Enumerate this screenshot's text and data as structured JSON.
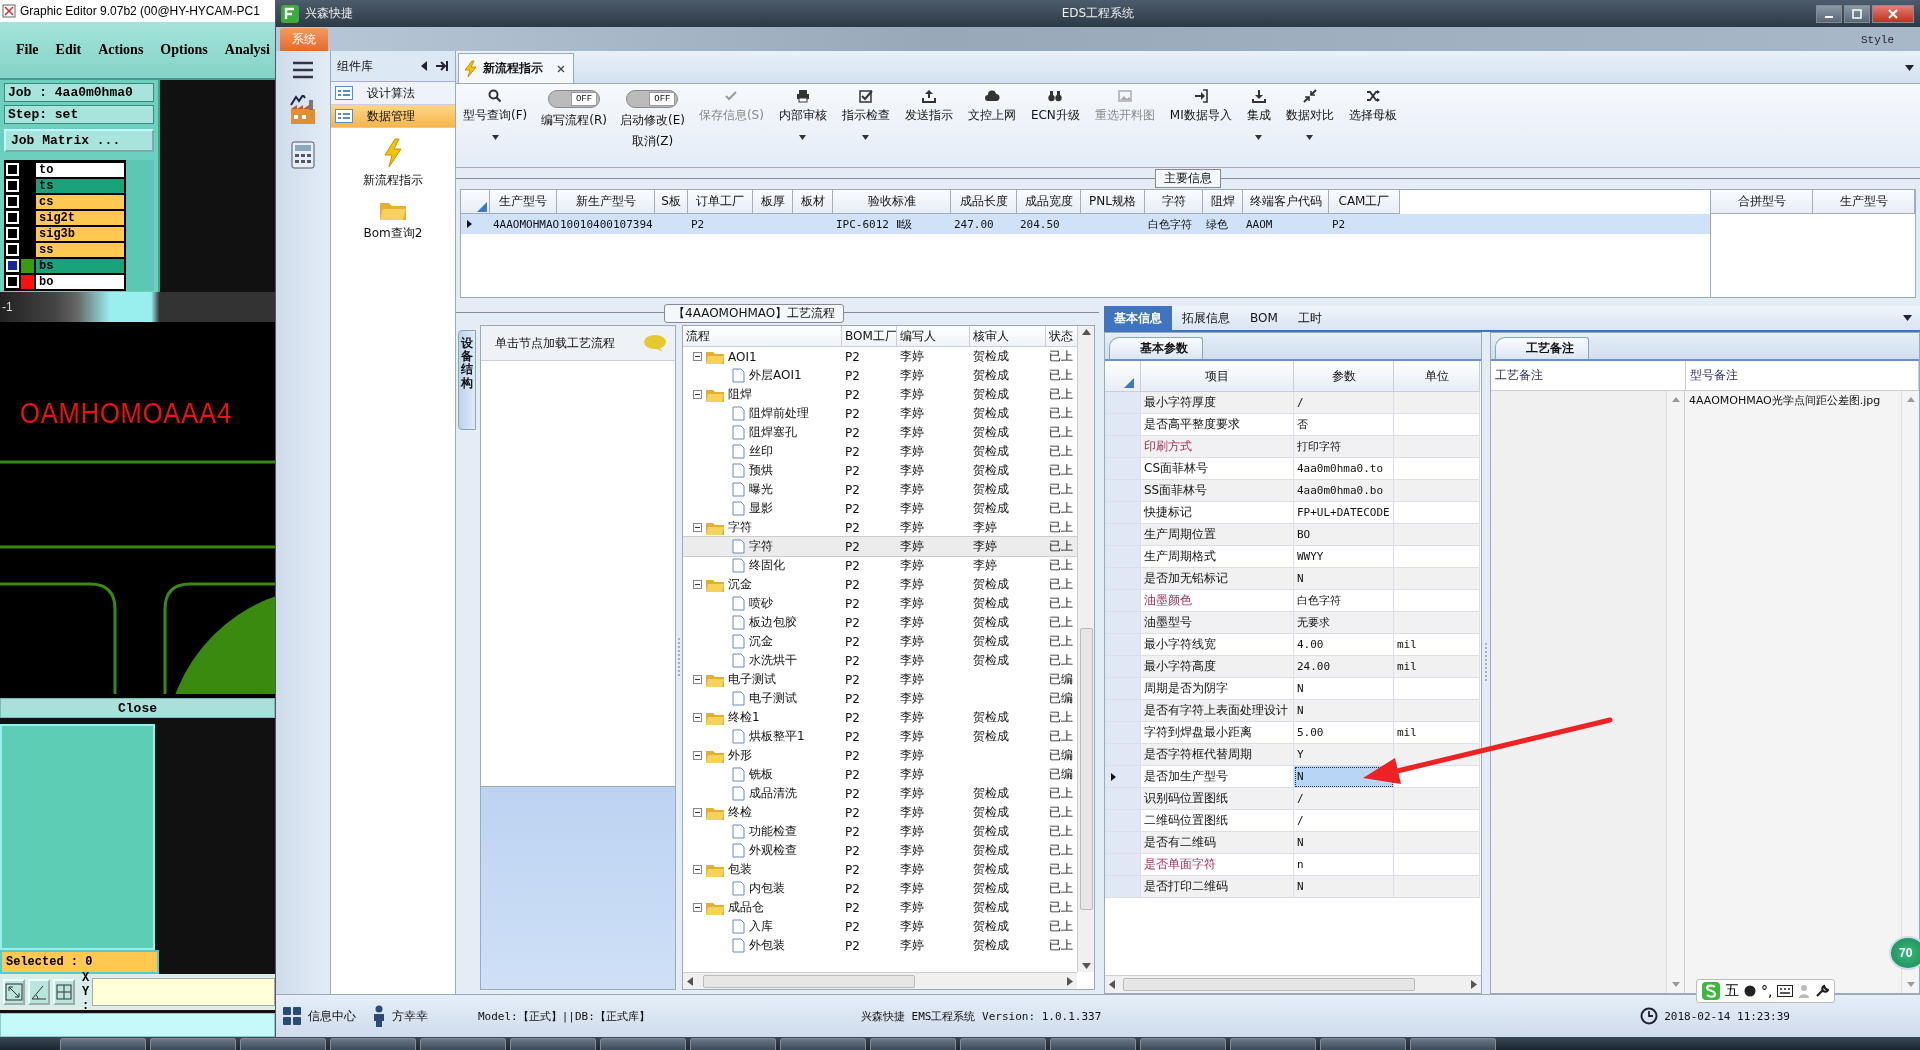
{
  "graphic_editor": {
    "title": "Graphic Editor 9.07b2 (00@HY-HYCAM-PC1",
    "menu": [
      "File",
      "Edit",
      "Actions",
      "Options",
      "Analysi"
    ],
    "job": "Job : 4aa0m0hma0",
    "step": "Step: set",
    "matrix_button": "Job Matrix ...",
    "layers": [
      {
        "name": "to",
        "color": "#ffffff",
        "selected": false
      },
      {
        "name": "ts",
        "color": "#1aa37a",
        "selected": false
      },
      {
        "name": "cs",
        "color": "#ffc850",
        "selected": false
      },
      {
        "name": "sig2t",
        "color": "#ffc850",
        "selected": false
      },
      {
        "name": "sig3b",
        "color": "#ffc850",
        "selected": false
      },
      {
        "name": "ss",
        "color": "#ffc850",
        "selected": false
      },
      {
        "name": "bs",
        "color": "#1aa37a",
        "swatch": {
          "color": "#3a9a10"
        },
        "selected": true
      },
      {
        "name": "bo",
        "color": "#ffffff",
        "swatch": {
          "color": "#ff1010"
        },
        "selected": false
      }
    ],
    "ruler": "-1",
    "canvas_text": "OAMHOMOAAA4",
    "close_button": "Close",
    "selected_count": "Selected : 0",
    "xy_label": "X Y :"
  },
  "window": {
    "app_name": "兴森快捷",
    "title": "EDS工程系统"
  },
  "system_menu": {
    "label": "系统",
    "background_text": "Style"
  },
  "component_panel": {
    "title": "组件库",
    "items": [
      {
        "label": "设计算法",
        "selected": false
      },
      {
        "label": "数据管理",
        "selected": true
      }
    ],
    "launchers": [
      {
        "label": "新流程指示",
        "kind": "bolt"
      },
      {
        "label": "Bom查询2",
        "kind": "folder"
      }
    ]
  },
  "document_tab": {
    "label": "新流程指示",
    "selected": true
  },
  "toolbar": [
    {
      "kind": "button",
      "label": "型号查询(F)",
      "dropdown": true,
      "disabled": false
    },
    {
      "kind": "toggle",
      "label": "编写流程(R)",
      "toggle": "OFF",
      "on": false
    },
    {
      "kind": "toggle",
      "label": "启动修改(E)",
      "sublabel": "取消(Z)",
      "toggle": "OFF",
      "on": false
    },
    {
      "kind": "button",
      "label": "保存信息(S)",
      "dropdown": false,
      "disabled": true
    },
    {
      "kind": "button",
      "label": "内部审核",
      "dropdown": true,
      "disabled": false
    },
    {
      "kind": "button",
      "label": "指示检查",
      "dropdown": true,
      "disabled": false
    },
    {
      "kind": "button",
      "label": "发送指示",
      "dropdown": false,
      "disabled": false
    },
    {
      "kind": "button",
      "label": "文控上网",
      "dropdown": false,
      "disabled": false
    },
    {
      "kind": "button",
      "label": "ECN升级",
      "dropdown": false,
      "disabled": false
    },
    {
      "kind": "button",
      "label": "重选开料图",
      "dropdown": false,
      "disabled": true
    },
    {
      "kind": "button",
      "label": "MI数据导入",
      "dropdown": false,
      "disabled": false
    },
    {
      "kind": "button",
      "label": "集成",
      "dropdown": true,
      "disabled": false
    },
    {
      "kind": "button",
      "label": "数据对比",
      "dropdown": true,
      "disabled": false
    },
    {
      "kind": "button",
      "label": "选择母板",
      "dropdown": false,
      "disabled": false
    }
  ],
  "main_info": {
    "title": "主要信息",
    "columns": [
      "生产型号",
      "新生产型号",
      "S板",
      "订单工厂",
      "板厚",
      "板材",
      "验收标准",
      "成品长度",
      "成品宽度",
      "PNL规格",
      "字符",
      "阻焊",
      "终端客户代码",
      "CAM工厂"
    ],
    "rows": [
      {
        "selected": true,
        "cells": [
          "4AAOMOHMAO",
          "10010400107394",
          "",
          "P2",
          "",
          "",
          "IPC-6012 Ⅱ级",
          "247.00",
          "204.50",
          "",
          "白色字符",
          "绿色",
          "AAOM",
          "P2"
        ]
      }
    ],
    "side_columns": [
      "合拼型号",
      "生产型号"
    ]
  },
  "process_flow": {
    "title": "【4AAOMOHMAO】工艺流程",
    "side_tab": "设备结构",
    "hint": "单击节点加载工艺流程",
    "columns": [
      "流程",
      "BOM工厂",
      "编写人",
      "核审人",
      "状态"
    ],
    "nodes": [
      {
        "name": "AOI1",
        "factory": "P2",
        "author": "李婷",
        "reviewer": "贺检成",
        "status": "已上",
        "selected": false,
        "children": [
          {
            "name": "外层AOI1",
            "factory": "P2",
            "author": "李婷",
            "reviewer": "贺检成",
            "status": "已上",
            "selected": false
          }
        ]
      },
      {
        "name": "阻焊",
        "factory": "P2",
        "author": "李婷",
        "reviewer": "贺检成",
        "status": "已上",
        "selected": false,
        "children": [
          {
            "name": "阻焊前处理",
            "factory": "P2",
            "author": "李婷",
            "reviewer": "贺检成",
            "status": "已上",
            "selected": false
          },
          {
            "name": "阻焊塞孔",
            "factory": "P2",
            "author": "李婷",
            "reviewer": "贺检成",
            "status": "已上",
            "selected": false
          },
          {
            "name": "丝印",
            "factory": "P2",
            "author": "李婷",
            "reviewer": "贺检成",
            "status": "已上",
            "selected": false
          },
          {
            "name": "预烘",
            "factory": "P2",
            "author": "李婷",
            "reviewer": "贺检成",
            "status": "已上",
            "selected": false
          },
          {
            "name": "曝光",
            "factory": "P2",
            "author": "李婷",
            "reviewer": "贺检成",
            "status": "已上",
            "selected": false
          },
          {
            "name": "显影",
            "factory": "P2",
            "author": "李婷",
            "reviewer": "贺检成",
            "status": "已上",
            "selected": false
          }
        ]
      },
      {
        "name": "字符",
        "factory": "P2",
        "author": "李婷",
        "reviewer": "李婷",
        "status": "已上",
        "selected": false,
        "children": [
          {
            "name": "字符",
            "factory": "P2",
            "author": "李婷",
            "reviewer": "李婷",
            "status": "已上",
            "selected": true
          },
          {
            "name": "终固化",
            "factory": "P2",
            "author": "李婷",
            "reviewer": "李婷",
            "status": "已上",
            "selected": false
          }
        ]
      },
      {
        "name": "沉金",
        "factory": "P2",
        "author": "李婷",
        "reviewer": "贺检成",
        "status": "已上",
        "selected": false,
        "children": [
          {
            "name": "喷砂",
            "factory": "P2",
            "author": "李婷",
            "reviewer": "贺检成",
            "status": "已上",
            "selected": false
          },
          {
            "name": "板边包胶",
            "factory": "P2",
            "author": "李婷",
            "reviewer": "贺检成",
            "status": "已上",
            "selected": false
          },
          {
            "name": "沉金",
            "factory": "P2",
            "author": "李婷",
            "reviewer": "贺检成",
            "status": "已上",
            "selected": false
          },
          {
            "name": "水洗烘干",
            "factory": "P2",
            "author": "李婷",
            "reviewer": "贺检成",
            "status": "已上",
            "selected": false
          }
        ]
      },
      {
        "name": "电子测试",
        "factory": "P2",
        "author": "李婷",
        "status": "已编",
        "selected": false,
        "children": [
          {
            "name": "电子测试",
            "factory": "P2",
            "author": "李婷",
            "status": "已编",
            "selected": false
          }
        ]
      },
      {
        "name": "终检1",
        "factory": "P2",
        "author": "李婷",
        "reviewer": "贺检成",
        "status": "已上",
        "selected": false,
        "children": [
          {
            "name": "烘板整平1",
            "factory": "P2",
            "author": "李婷",
            "reviewer": "贺检成",
            "status": "已上",
            "selected": false
          }
        ]
      },
      {
        "name": "外形",
        "factory": "P2",
        "author": "李婷",
        "status": "已编",
        "selected": false,
        "children": [
          {
            "name": "铣板",
            "factory": "P2",
            "author": "李婷",
            "status": "已编",
            "selected": false
          },
          {
            "name": "成品清洗",
            "factory": "P2",
            "author": "李婷",
            "reviewer": "贺检成",
            "status": "已上",
            "selected": false
          }
        ]
      },
      {
        "name": "终检",
        "factory": "P2",
        "author": "李婷",
        "reviewer": "贺检成",
        "status": "已上",
        "selected": false,
        "children": [
          {
            "name": "功能检查",
            "factory": "P2",
            "author": "李婷",
            "reviewer": "贺检成",
            "status": "已上",
            "selected": false
          },
          {
            "name": "外观检查",
            "factory": "P2",
            "author": "李婷",
            "reviewer": "贺检成",
            "status": "已上",
            "selected": false
          }
        ]
      },
      {
        "name": "包装",
        "factory": "P2",
        "author": "李婷",
        "reviewer": "贺检成",
        "status": "已上",
        "selected": false,
        "children": [
          {
            "name": "内包装",
            "factory": "P2",
            "author": "李婷",
            "reviewer": "贺检成",
            "status": "已上",
            "selected": false
          }
        ]
      },
      {
        "name": "成品仓",
        "factory": "P2",
        "author": "李婷",
        "reviewer": "贺检成",
        "status": "已上",
        "selected": false,
        "children": [
          {
            "name": "入库",
            "factory": "P2",
            "author": "李婷",
            "reviewer": "贺检成",
            "status": "已上",
            "selected": false
          },
          {
            "name": "外包装",
            "factory": "P2",
            "author": "李婷",
            "reviewer": "贺检成",
            "status": "已上",
            "selected": false
          }
        ]
      }
    ]
  },
  "details": {
    "tabs": [
      {
        "label": "基本信息",
        "selected": true
      },
      {
        "label": "拓展信息",
        "selected": false
      },
      {
        "label": "BOM",
        "selected": false
      },
      {
        "label": "工时",
        "selected": false
      }
    ],
    "subtab": "基本参数",
    "columns": [
      "项目",
      "参数",
      "单位"
    ],
    "rows": [
      {
        "item": "最小字符厚度",
        "value": "/",
        "highlighted": false,
        "selected": false
      },
      {
        "item": "是否高平整度要求",
        "value": "否",
        "highlighted": false,
        "selected": false
      },
      {
        "item": "印刷方式",
        "value": "打印字符",
        "highlighted": true,
        "selected": false
      },
      {
        "item": "CS面菲林号",
        "value": "4aa0m0hma0.to",
        "highlighted": false,
        "selected": false
      },
      {
        "item": "SS面菲林号",
        "value": "4aa0m0hma0.bo",
        "highlighted": false,
        "selected": false
      },
      {
        "item": "快捷标记",
        "value": "FP+UL+DATECODE",
        "highlighted": false,
        "selected": false
      },
      {
        "item": "生产周期位置",
        "value": "BO",
        "highlighted": false,
        "selected": false
      },
      {
        "item": "生产周期格式",
        "value": "WWYY",
        "highlighted": false,
        "selected": false
      },
      {
        "item": "是否加无铅标记",
        "value": "N",
        "highlighted": false,
        "selected": false
      },
      {
        "item": "油墨颜色",
        "value": "白色字符",
        "highlighted": true,
        "selected": false
      },
      {
        "item": "油墨型号",
        "value": "无要求",
        "highlighted": false,
        "selected": false
      },
      {
        "item": "最小字符线宽",
        "value": "4.00",
        "unit": "mil",
        "highlighted": false,
        "selected": false
      },
      {
        "item": "最小字符高度",
        "value": "24.00",
        "unit": "mil",
        "highlighted": false,
        "selected": false
      },
      {
        "item": "周期是否为阴字",
        "value": "N",
        "highlighted": false,
        "selected": false
      },
      {
        "item": "是否有字符上表面处理设计",
        "value": "N",
        "highlighted": false,
        "selected": false
      },
      {
        "item": "字符到焊盘最小距离",
        "value": "5.00",
        "unit": "mil",
        "highlighted": false,
        "selected": false
      },
      {
        "item": "是否字符框代替周期",
        "value": "Y",
        "highlighted": false,
        "selected": false
      },
      {
        "item": "是否加生产型号",
        "value": "N",
        "highlighted": false,
        "selected": true
      },
      {
        "item": "识别码位置图纸",
        "value": "/",
        "highlighted": false,
        "selected": false
      },
      {
        "item": "二维码位置图纸",
        "value": "/",
        "highlighted": false,
        "selected": false
      },
      {
        "item": "是否有二维码",
        "value": "N",
        "highlighted": false,
        "selected": false
      },
      {
        "item": "是否单面字符",
        "value": "n",
        "highlighted": true,
        "selected": false
      },
      {
        "item": "是否打印二维码",
        "value": "N",
        "highlighted": false,
        "selected": false
      }
    ]
  },
  "notes": {
    "tab": "工艺备注",
    "columns": [
      "工艺备注",
      "型号备注"
    ],
    "model_note": "4AAOMOHMAO光学点间距公差图.jpg"
  },
  "status_bar": {
    "info_center": "信息中心",
    "user": "方幸幸",
    "environment": "Model:【正式】||DB:【正式库】",
    "version": "兴森快捷 EMS工程系统 Version: 1.0.1.337",
    "datetime": "2018-02-14 11:23:39"
  },
  "ime_bar": {
    "mode": "五",
    "punctuation": "°,"
  },
  "floating_badge": "70"
}
